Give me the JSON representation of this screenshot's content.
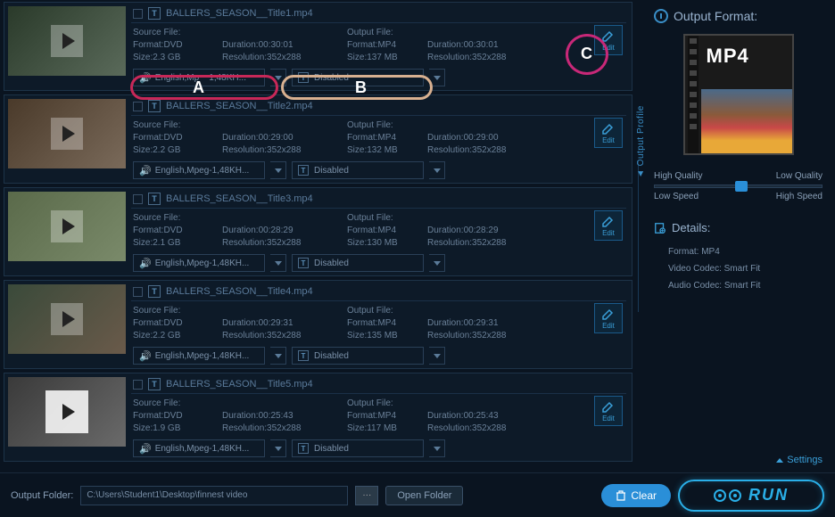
{
  "items": [
    {
      "title": "BALLERS_SEASON__Title1.mp4",
      "srcFormat": "Format:DVD",
      "srcSize": "Size:2.3 GB",
      "srcDuration": "Duration:00:30:01",
      "srcRes": "Resolution:352x288",
      "outFormat": "Format:MP4",
      "outSize": "Size:137 MB",
      "outDuration": "Duration:00:30:01",
      "outRes": "Resolution:352x288",
      "audio": "English,Mp",
      "audioSuffix": "1,48KH...",
      "sub": "Disabled"
    },
    {
      "title": "BALLERS_SEASON__Title2.mp4",
      "srcFormat": "Format:DVD",
      "srcSize": "Size:2.2 GB",
      "srcDuration": "Duration:00:29:00",
      "srcRes": "Resolution:352x288",
      "outFormat": "Format:MP4",
      "outSize": "Size:132 MB",
      "outDuration": "Duration:00:29:00",
      "outRes": "Resolution:352x288",
      "audio": "English,Mpeg-1,48KH...",
      "sub": "Disabled"
    },
    {
      "title": "BALLERS_SEASON__Title3.mp4",
      "srcFormat": "Format:DVD",
      "srcSize": "Size:2.1 GB",
      "srcDuration": "Duration:00:28:29",
      "srcRes": "Resolution:352x288",
      "outFormat": "Format:MP4",
      "outSize": "Size:130 MB",
      "outDuration": "Duration:00:28:29",
      "outRes": "Resolution:352x288",
      "audio": "English,Mpeg-1,48KH...",
      "sub": "Disabled"
    },
    {
      "title": "BALLERS_SEASON__Title4.mp4",
      "srcFormat": "Format:DVD",
      "srcSize": "Size:2.2 GB",
      "srcDuration": "Duration:00:29:31",
      "srcRes": "Resolution:352x288",
      "outFormat": "Format:MP4",
      "outSize": "Size:135 MB",
      "outDuration": "Duration:00:29:31",
      "outRes": "Resolution:352x288",
      "audio": "English,Mpeg-1,48KH...",
      "sub": "Disabled"
    },
    {
      "title": "BALLERS_SEASON__Title5.mp4",
      "srcFormat": "Format:DVD",
      "srcSize": "Size:1.9 GB",
      "srcDuration": "Duration:00:25:43",
      "srcRes": "Resolution:352x288",
      "outFormat": "Format:MP4",
      "outSize": "Size:117 MB",
      "outDuration": "Duration:00:25:43",
      "outRes": "Resolution:352x288",
      "audio": "English,Mpeg-1,48KH...",
      "sub": "Disabled"
    }
  ],
  "labels": {
    "sourceFile": "Source File:",
    "outputFile": "Output File:",
    "edit": "Edit"
  },
  "right": {
    "outputFormat": "Output Format:",
    "profileLabel": "Output Profile",
    "mp4": "MP4",
    "highQuality": "High Quality",
    "lowQuality": "Low Quality",
    "lowSpeed": "Low Speed",
    "highSpeed": "High Speed",
    "details": "Details:",
    "formatLine": "Format: MP4",
    "videoCodec": "Video Codec: Smart Fit",
    "audioCodec": "Audio Codec: Smart Fit",
    "settings": "Settings"
  },
  "bottom": {
    "outputFolderLabel": "Output Folder:",
    "outputFolderPath": "C:\\Users\\Student1\\Desktop\\finnest video",
    "browse": "···",
    "openFolder": "Open Folder",
    "clear": "Clear",
    "run": "RUN"
  },
  "annotations": {
    "a": "A",
    "b": "B",
    "c": "C"
  }
}
